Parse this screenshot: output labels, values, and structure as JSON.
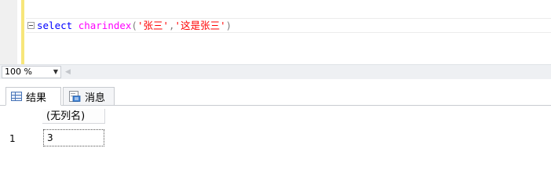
{
  "editor": {
    "query": {
      "keyword": "select",
      "function": "charindex",
      "open_paren": "(",
      "arg1": "'张三'",
      "comma": ",",
      "arg2": "'这是张三'",
      "close_paren": ")"
    }
  },
  "zoom": {
    "value": "100 %"
  },
  "result_tabs": [
    {
      "label": "结果",
      "icon": "grid-icon",
      "selected": true
    },
    {
      "label": "消息",
      "icon": "messages-icon",
      "selected": false
    }
  ],
  "results_grid": {
    "columns": [
      "(无列名)"
    ],
    "rows": [
      {
        "row_number": "1",
        "values": [
          "3"
        ]
      }
    ]
  },
  "colors": {
    "keyword": "#0000ff",
    "function": "#ff00ff",
    "punctuation": "#808080",
    "string": "#ff0000",
    "change_bar": "#f7e67a"
  }
}
